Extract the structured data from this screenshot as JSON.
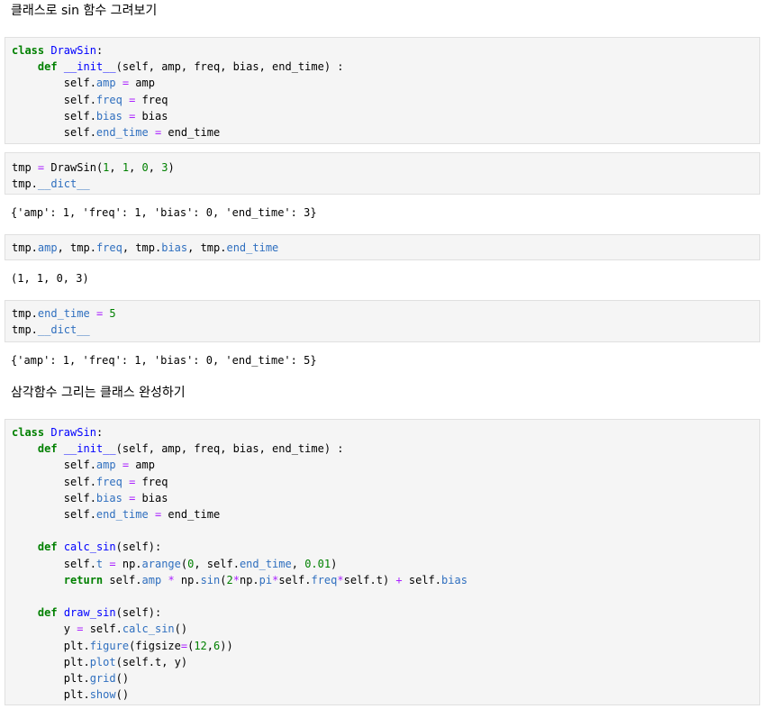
{
  "markdown": {
    "heading1": "클래스로 sin 함수 그려보기",
    "heading2": "삼각함수 그리는 클래스 완성하기"
  },
  "cells": {
    "c1": {
      "l1": [
        "class",
        " ",
        "DrawSin",
        ":"
      ],
      "l2": [
        "    ",
        "def",
        " ",
        "__init__",
        "(self, amp, freq, bias, end_time) :"
      ],
      "l3": [
        "        self.",
        "amp",
        " ",
        "=",
        " amp"
      ],
      "l4": [
        "        self.",
        "freq",
        " ",
        "=",
        " freq"
      ],
      "l5": [
        "        self.",
        "bias",
        " ",
        "=",
        " bias"
      ],
      "l6": [
        "        self.",
        "end_time",
        " ",
        "=",
        " end_time"
      ]
    },
    "c2": {
      "l1": [
        "tmp ",
        "=",
        " DrawSin(",
        "1",
        ", ",
        "1",
        ", ",
        "0",
        ", ",
        "3",
        ")"
      ],
      "l2": [
        "tmp.",
        "__dict__"
      ]
    },
    "c3": {
      "l1": [
        "tmp.",
        "amp",
        ", tmp.",
        "freq",
        ", tmp.",
        "bias",
        ", tmp.",
        "end_time"
      ]
    },
    "c4": {
      "l1": [
        "tmp.",
        "end_time",
        " ",
        "=",
        " ",
        "5"
      ],
      "l2": [
        "tmp.",
        "__dict__"
      ]
    },
    "c5": {
      "l1": [
        "class",
        " ",
        "DrawSin",
        ":"
      ],
      "l2": [
        "    ",
        "def",
        " ",
        "__init__",
        "(self, amp, freq, bias, end_time) :"
      ],
      "l3": [
        "        self.",
        "amp",
        " ",
        "=",
        " amp"
      ],
      "l4": [
        "        self.",
        "freq",
        " ",
        "=",
        " freq"
      ],
      "l5": [
        "        self.",
        "bias",
        " ",
        "=",
        " bias"
      ],
      "l6": [
        "        self.",
        "end_time",
        " ",
        "=",
        " end_time"
      ],
      "l8": [
        "    ",
        "def",
        " ",
        "calc_sin",
        "(self):"
      ],
      "l9": [
        "        self.",
        "t",
        " ",
        "=",
        " np.",
        "arange",
        "(",
        "0",
        ", self.",
        "end_time",
        ", ",
        "0.01",
        ")"
      ],
      "l10": [
        "        ",
        "return",
        " self.",
        "amp",
        " ",
        "*",
        " np.",
        "sin",
        "(",
        "2",
        "*",
        "np.",
        "pi",
        "*",
        "self.",
        "freq",
        "*",
        "self.",
        "t",
        ") ",
        "+",
        " self.",
        "bias"
      ],
      "l12": [
        "    ",
        "def",
        " ",
        "draw_sin",
        "(self):"
      ],
      "l13": [
        "        y ",
        "=",
        " self.",
        "calc_sin",
        "()"
      ],
      "l14": [
        "        plt.",
        "figure",
        "(figsize",
        "=",
        "(",
        "12",
        ",",
        "6",
        "))"
      ],
      "l15": [
        "        plt.",
        "plot",
        "(self.",
        "t",
        ", y)"
      ],
      "l16": [
        "        plt.",
        "grid",
        "()"
      ],
      "l17": [
        "        plt.",
        "show",
        "()"
      ]
    }
  },
  "outputs": {
    "o2": "{'amp': 1, 'freq': 1, 'bias': 0, 'end_time': 3}",
    "o3": "(1, 1, 0, 3)",
    "o4": "{'amp': 1, 'freq': 1, 'bias': 0, 'end_time': 5}"
  }
}
